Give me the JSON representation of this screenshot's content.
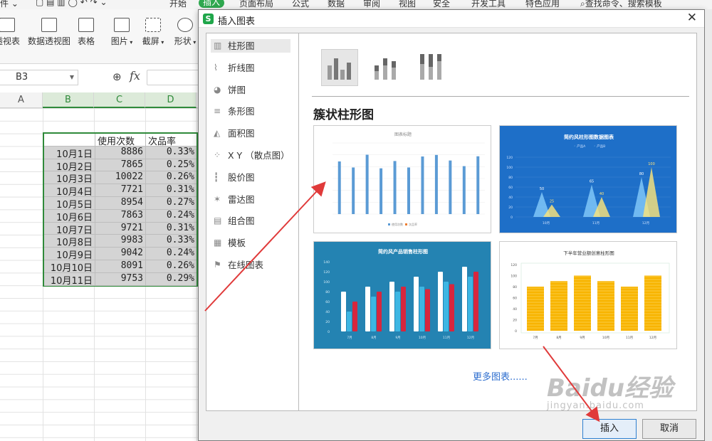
{
  "menubar": {
    "items": [
      "件 ⌄",
      "开始",
      "插入",
      "页面布局",
      "公式",
      "数据",
      "审阅",
      "视图",
      "安全",
      "开发工具",
      "特色应用",
      "查找命令、搜索模板"
    ],
    "active": "插入"
  },
  "ribbon": {
    "items": [
      "透视表",
      "数据透视图",
      "表格",
      "图片",
      "截屏",
      "形状"
    ]
  },
  "formula_bar": {
    "cell_ref": "B3",
    "fx_label": "fx"
  },
  "sheet": {
    "columns": [
      "A",
      "B",
      "C",
      "D"
    ],
    "header_row": [
      "",
      "使用次数",
      "次品率"
    ],
    "rows": [
      [
        "10月1日",
        "8886",
        "0.33%"
      ],
      [
        "10月2日",
        "7865",
        "0.25%"
      ],
      [
        "10月3日",
        "10022",
        "0.26%"
      ],
      [
        "10月4日",
        "7721",
        "0.31%"
      ],
      [
        "10月5日",
        "8954",
        "0.27%"
      ],
      [
        "10月6日",
        "7863",
        "0.24%"
      ],
      [
        "10月7日",
        "9721",
        "0.31%"
      ],
      [
        "10月8日",
        "9983",
        "0.33%"
      ],
      [
        "10月9日",
        "9042",
        "0.24%"
      ],
      [
        "10月10日",
        "8091",
        "0.26%"
      ],
      [
        "10月11日",
        "9753",
        "0.29%"
      ]
    ]
  },
  "dialog": {
    "title": "插入图表",
    "close": "✕",
    "sidebar": [
      {
        "label": "柱形图",
        "icon": "column-chart-icon"
      },
      {
        "label": "折线图",
        "icon": "line-chart-icon"
      },
      {
        "label": "饼图",
        "icon": "pie-chart-icon"
      },
      {
        "label": "条形图",
        "icon": "bar-chart-icon"
      },
      {
        "label": "面积图",
        "icon": "area-chart-icon"
      },
      {
        "label": "X Y （散点图）",
        "icon": "scatter-chart-icon"
      },
      {
        "label": "股价图",
        "icon": "stock-chart-icon"
      },
      {
        "label": "雷达图",
        "icon": "radar-chart-icon"
      },
      {
        "label": "组合图",
        "icon": "combo-chart-icon"
      },
      {
        "label": "模板",
        "icon": "template-icon"
      },
      {
        "label": "在线图表",
        "icon": "online-chart-icon"
      }
    ],
    "selected_sidebar": "柱形图",
    "subtypes": [
      "clustered-column",
      "stacked-column",
      "percent-stacked-column"
    ],
    "section_title": "簇状柱形图",
    "templates": [
      {
        "title": "图表标题",
        "legend": [
          "使用次数",
          "次品率"
        ]
      },
      {
        "title": "简约风柱形图数据图表",
        "legend": [
          "产品A",
          "产品B"
        ],
        "labels": [
          "50",
          "25",
          "65",
          "40",
          "80",
          "100"
        ],
        "x": [
          "10月",
          "11月",
          "12月"
        ],
        "y": [
          "120",
          "100",
          "80",
          "60",
          "40",
          "20",
          "0"
        ]
      },
      {
        "title": "简约风产品销售柱形图",
        "x": [
          "7月",
          "8月",
          "9月",
          "10月",
          "11月",
          "12月"
        ],
        "y": [
          "140",
          "120",
          "100",
          "80",
          "60",
          "40",
          "20",
          "0"
        ]
      },
      {
        "title": "下半年营业额创意柱形图",
        "x": [
          "7月",
          "8月",
          "9月",
          "10月",
          "11月",
          "12月"
        ],
        "y": [
          "120",
          "100",
          "80",
          "60",
          "40",
          "20",
          "0"
        ]
      }
    ],
    "more_link": "更多图表......",
    "insert_button": "插入",
    "cancel_button": "取消"
  },
  "watermark": {
    "big": "Baidu经验",
    "small": "jingyan.baidu.com"
  },
  "colors": {
    "accent_green": "#2fa84f",
    "selection_green": "#2f8a3a",
    "arrow_red": "#e03a3a",
    "link_blue": "#2f6fcf"
  }
}
